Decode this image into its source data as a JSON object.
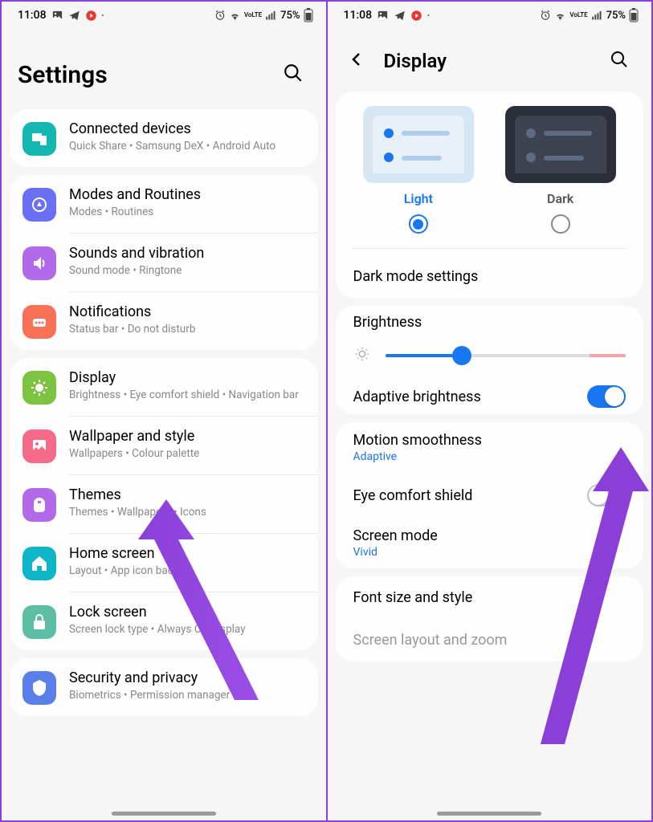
{
  "status": {
    "time": "11:08",
    "battery": "75%",
    "network": "VoLTE"
  },
  "left": {
    "title": "Settings",
    "items": [
      {
        "title": "Connected devices",
        "subtitle": "Quick Share  •  Samsung DeX  •  Android Auto",
        "iconColor": "#13b8b0",
        "iconName": "connected-devices-icon"
      },
      {
        "title": "Modes and Routines",
        "subtitle": "Modes  •  Routines",
        "iconColor": "#6b6ff5",
        "iconName": "modes-icon"
      },
      {
        "title": "Sounds and vibration",
        "subtitle": "Sound mode  •  Ringtone",
        "iconColor": "#b36ae8",
        "iconName": "sound-icon"
      },
      {
        "title": "Notifications",
        "subtitle": "Status bar  •  Do not disturb",
        "iconColor": "#f97059",
        "iconName": "notifications-icon"
      },
      {
        "title": "Display",
        "subtitle": "Brightness  •  Eye comfort shield  •  Navigation bar",
        "iconColor": "#7cc342",
        "iconName": "display-icon"
      },
      {
        "title": "Wallpaper and style",
        "subtitle": "Wallpapers  •  Colour palette",
        "iconColor": "#f76b8a",
        "iconName": "wallpaper-icon"
      },
      {
        "title": "Themes",
        "subtitle": "Themes  •  Wallpapers  •  Icons",
        "iconColor": "#b36ae8",
        "iconName": "themes-icon"
      },
      {
        "title": "Home screen",
        "subtitle": "Layout  •  App icon badges",
        "iconColor": "#0fb5c9",
        "iconName": "home-icon"
      },
      {
        "title": "Lock screen",
        "subtitle": "Screen lock type  •  Always On Display",
        "iconColor": "#5ebea3",
        "iconName": "lock-icon"
      },
      {
        "title": "Security and privacy",
        "subtitle": "Biometrics  •  Permission manager",
        "iconColor": "#5b7fe8",
        "iconName": "security-icon"
      }
    ]
  },
  "right": {
    "title": "Display",
    "themes": {
      "light": "Light",
      "dark": "Dark"
    },
    "dark_mode_settings": "Dark mode settings",
    "brightness": "Brightness",
    "adaptive_brightness": "Adaptive brightness",
    "motion_smoothness": "Motion smoothness",
    "motion_smoothness_value": "Adaptive",
    "eye_comfort": "Eye comfort shield",
    "screen_mode": "Screen mode",
    "screen_mode_value": "Vivid",
    "font_size": "Font size and style",
    "screen_layout": "Screen layout and zoom"
  }
}
